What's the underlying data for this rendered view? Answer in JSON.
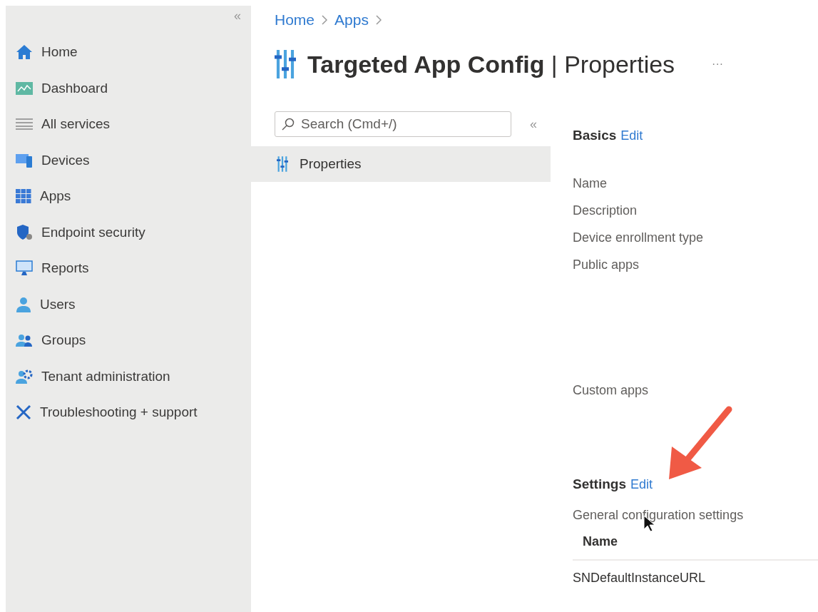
{
  "sidebar": {
    "collapse": "«",
    "items": [
      {
        "label": "Home"
      },
      {
        "label": "Dashboard"
      },
      {
        "label": "All services"
      },
      {
        "label": "Devices"
      },
      {
        "label": "Apps"
      },
      {
        "label": "Endpoint security"
      },
      {
        "label": "Reports"
      },
      {
        "label": "Users"
      },
      {
        "label": "Groups"
      },
      {
        "label": "Tenant administration"
      },
      {
        "label": "Troubleshooting + support"
      }
    ]
  },
  "breadcrumb": [
    "Home",
    "Apps"
  ],
  "title": {
    "text": "**Targeted App Config** | Properties",
    "more": "···"
  },
  "menu": {
    "search": {
      "placeholder": "Search (Cmd+/)"
    },
    "collapse": "«",
    "items": [
      {
        "label": "Properties",
        "selected": true
      }
    ]
  },
  "basics": {
    "heading": "Basics",
    "edit": "Edit",
    "fields": [
      "Name",
      "Description",
      "Device enrollment type",
      "Public apps"
    ],
    "custom": "Custom apps"
  },
  "settings": {
    "heading": "Settings",
    "edit": "Edit",
    "subheading": "General configuration settings",
    "table": {
      "columns": [
        "Name"
      ],
      "rows": [
        [
          "SNDefaultInstanceURL"
        ]
      ]
    }
  }
}
